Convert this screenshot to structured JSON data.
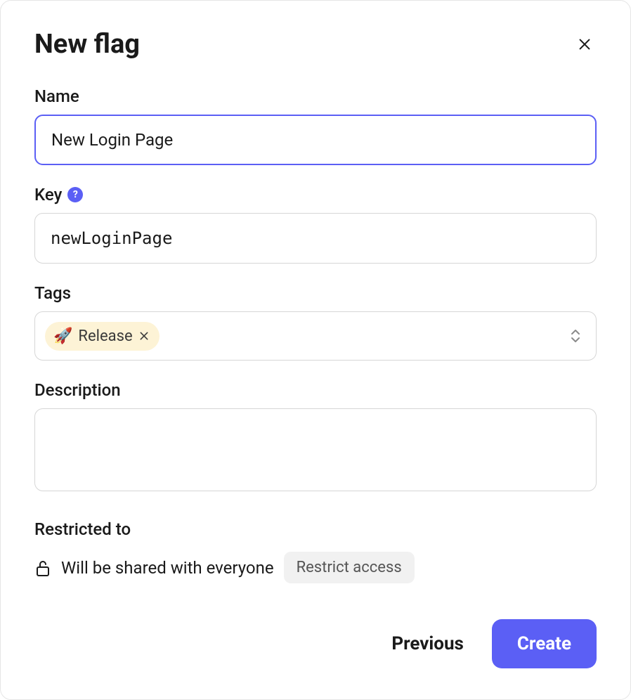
{
  "modal": {
    "title": "New flag"
  },
  "fields": {
    "name": {
      "label": "Name",
      "value": "New Login Page"
    },
    "key": {
      "label": "Key",
      "help": "?",
      "value": "newLoginPage"
    },
    "tags": {
      "label": "Tags",
      "items": [
        {
          "emoji": "🚀",
          "label": "Release"
        }
      ]
    },
    "description": {
      "label": "Description",
      "value": ""
    },
    "restricted": {
      "label": "Restricted to",
      "share_text": "Will be shared with everyone",
      "restrict_button": "Restrict access"
    }
  },
  "footer": {
    "previous": "Previous",
    "create": "Create"
  }
}
